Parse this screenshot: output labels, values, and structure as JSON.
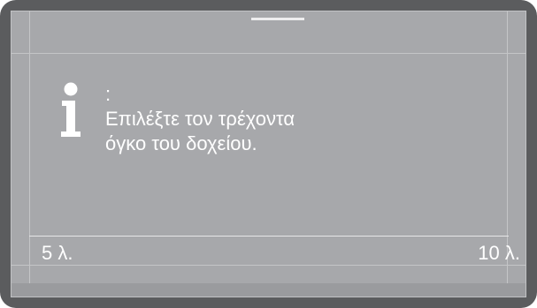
{
  "dialog": {
    "icon": "info-icon",
    "title": ":",
    "message_line1": "Επιλέξτε τον τρέχοντα",
    "message_line2": "όγκο του δοχείου."
  },
  "scale": {
    "min_label": "5 λ.",
    "max_label": "10 λ."
  },
  "colors": {
    "bezel": "#5b5c5e",
    "screen": "#a7a8ab",
    "text": "#ffffff"
  }
}
